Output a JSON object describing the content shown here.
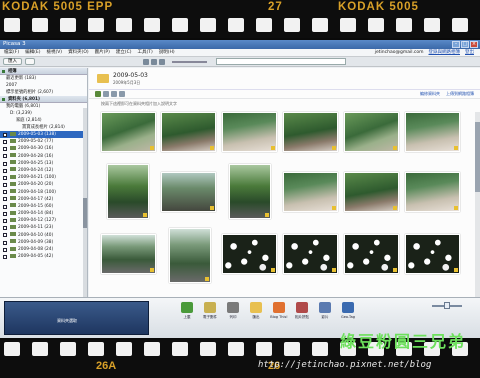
{
  "film": {
    "top_label_left": "KODAK  5005  EPP",
    "top_frame_num": "27",
    "top_label_right": "KODAK  5005",
    "bottom_frame_left": "26A",
    "bottom_frame_right": "26",
    "watermark": "綠豆粉圓三兄弟",
    "blog_url": "http://jetinchao.pixnet.net/blog"
  },
  "window": {
    "title": "Picasa 3",
    "menus": [
      "檔案(F)",
      "編輯(E)",
      "檢視(V)",
      "資料夾(O)",
      "圖片(P)",
      "建立(C)",
      "工具(T)",
      "說明(H)"
    ],
    "account": "jetinchao@gmail.com",
    "account_link": "登錄與網路相簿",
    "signout": "登出",
    "import_button": "匯入"
  },
  "sidebar": {
    "section1": "相簿",
    "section1_item": "最近更新 (183)",
    "year": "2007",
    "year_item": "標示星號的相片 (2,607)",
    "section2": "資料夾",
    "section2_count": "(6,801)",
    "tree": [
      "我的電腦 (6,801)",
      "D: (3,239)",
      "家庭 (2,814)",
      "寶寶成長相片 (2,814)"
    ],
    "folders": [
      "2009-05-03 (138)",
      "2009-05-02 (77)",
      "2009-04-30 (16)",
      "2009-04-28 (16)",
      "2009-04-25 (13)",
      "2009-04-24 (12)",
      "2009-04-21 (100)",
      "2009-04-20 (20)",
      "2009-04-18 (100)",
      "2009-04-17 (42)",
      "2009-04-15 (60)",
      "2009-04-14 (84)",
      "2009-04-12 (127)",
      "2009-04-11 (23)",
      "2009-04-10 (40)",
      "2009-04-09 (38)",
      "2009-04-08 (24)",
      "2009-04-05 (42)"
    ]
  },
  "album": {
    "title": "2009-05-03",
    "subtitle": "2009年5月3日",
    "caption": "按兩下這裡即可在資料夾相片加入說明文字",
    "link1": "編修資料夾",
    "link2": "上傳到網路相簿"
  },
  "status": {
    "count": "136 張相片",
    "date": "2009年5月3日",
    "size": "393.5MB"
  },
  "bottom": {
    "selected_label": "資料夾選取",
    "actions": [
      "上載",
      "電子郵件",
      "列印",
      "匯出",
      "Blog This!",
      "相片拼貼",
      "影片",
      "Geo-Tag"
    ],
    "action_colors": [
      "#4a9a3a",
      "#c8b050",
      "#7a7a7a",
      "#e8c050",
      "#e07030",
      "#b04a4a",
      "#5a7ab0",
      "#3a6ab0"
    ]
  },
  "thumbs_row_colors": [
    "#6a9a5a"
  ]
}
